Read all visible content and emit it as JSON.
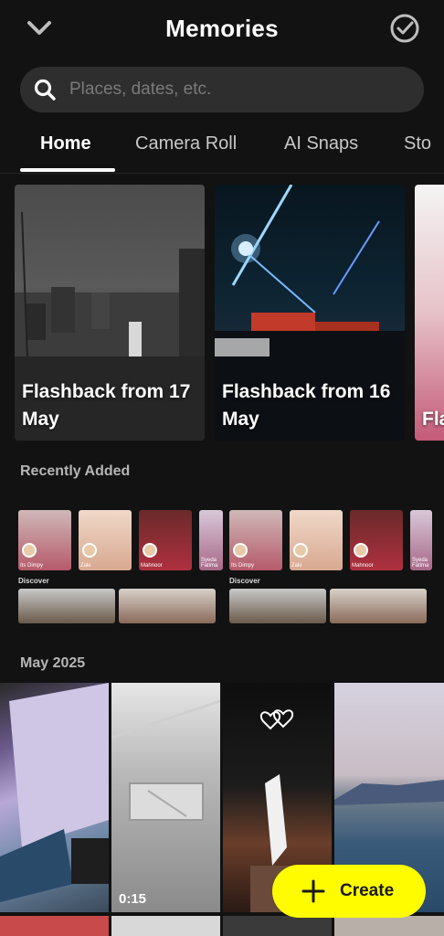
{
  "header": {
    "title": "Memories",
    "left_icon": "chevron-down-icon",
    "right_icon": "select-check-icon"
  },
  "search": {
    "placeholder": "Places, dates, etc."
  },
  "tabs": [
    {
      "label": "Home",
      "active": true
    },
    {
      "label": "Camera Roll",
      "active": false
    },
    {
      "label": "AI Snaps",
      "active": false
    },
    {
      "label": "Sto",
      "active": false
    }
  ],
  "flashbacks": [
    {
      "label": "Flashback from 17 May"
    },
    {
      "label": "Flashback from 16 May"
    },
    {
      "label": "Fla Ma"
    }
  ],
  "recently_added": {
    "title": "Recently Added",
    "stories": [
      {
        "names": [
          "Its Dimpy",
          "Zaki",
          "Mahnoor",
          "Syeda Fatima"
        ],
        "discover": "Discover"
      },
      {
        "names": [
          "Its Dimpy",
          "Zaki",
          "Mahnoor",
          "Syeda Fatima"
        ],
        "discover": "Discover"
      }
    ]
  },
  "month_section": {
    "title": "May 2025"
  },
  "grid": {
    "video_duration": "0:15"
  },
  "create_button": {
    "label": "Create"
  },
  "colors": {
    "accent": "#fffc00",
    "background": "#121212",
    "search_bg": "#2e2e2e"
  }
}
